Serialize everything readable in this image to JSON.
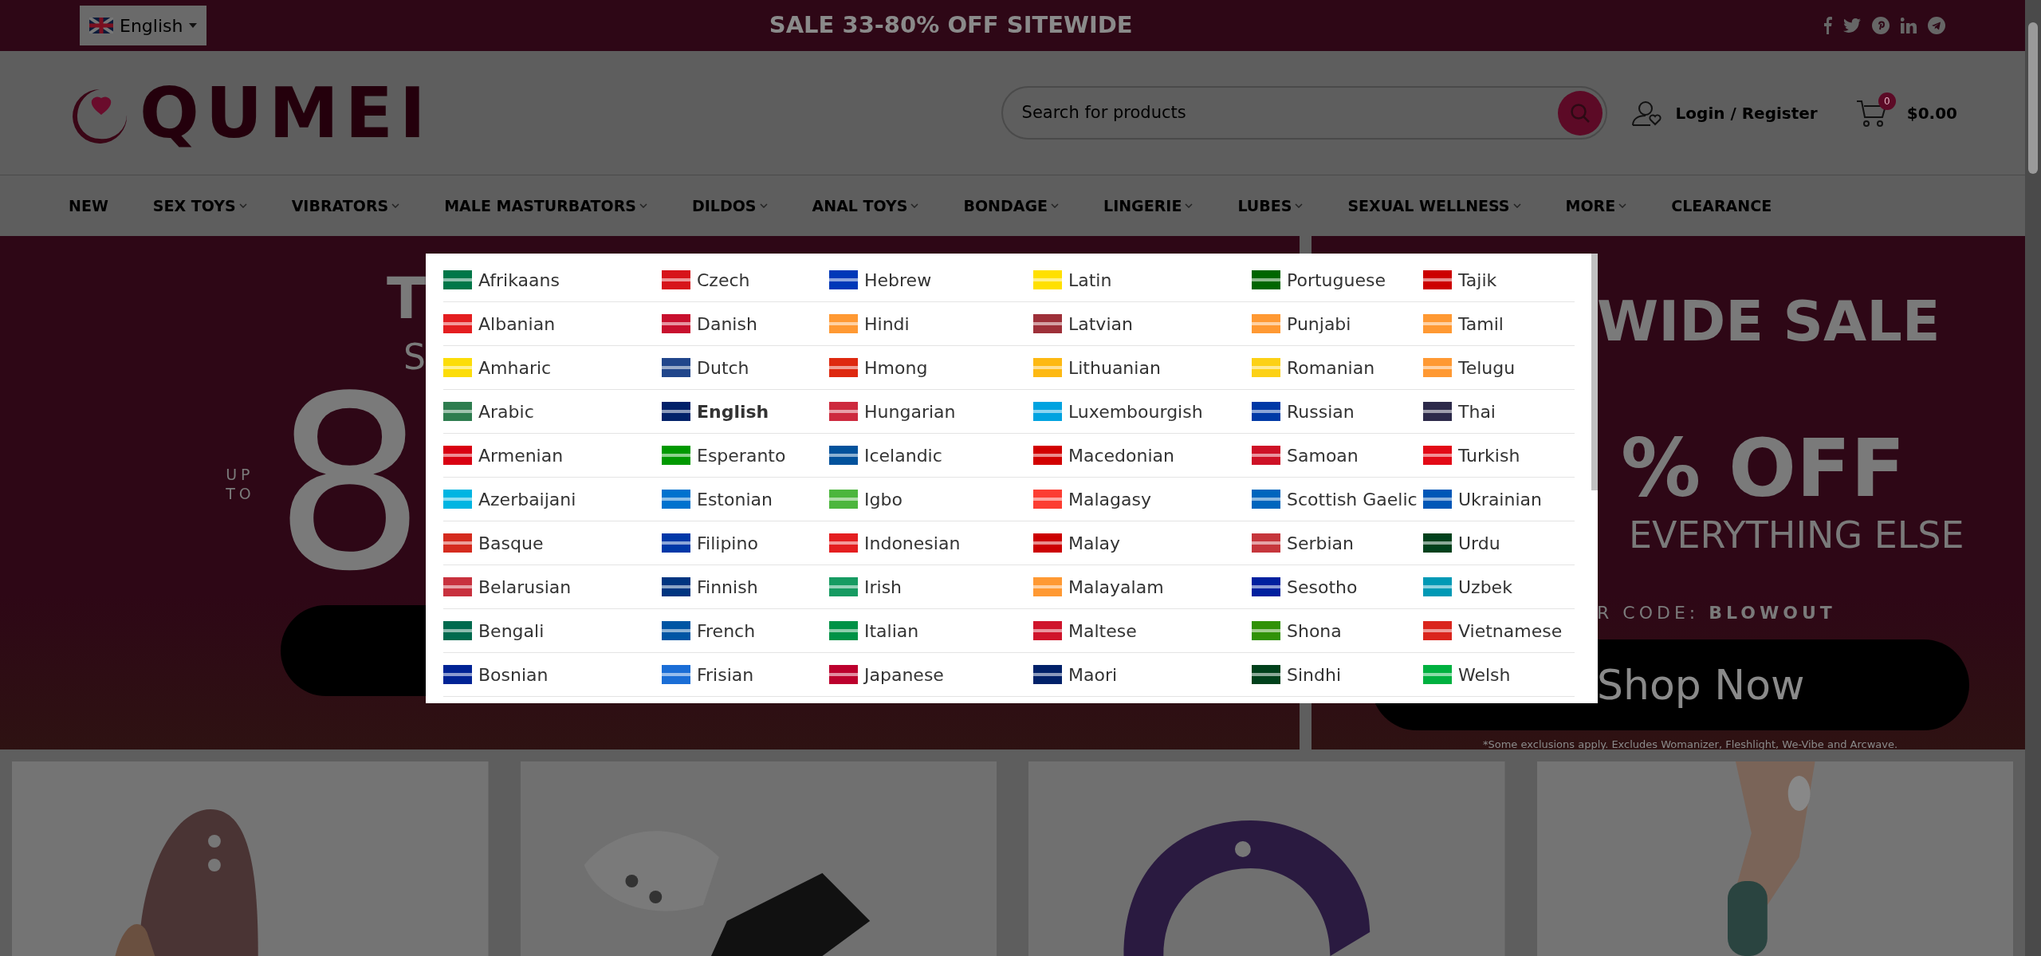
{
  "top_bar": {
    "language_select": "English",
    "promo": "SALE 33-80% OFF SITEWIDE"
  },
  "header": {
    "logo": "QUMEI",
    "search": {
      "placeholder": "Search for products"
    },
    "account": "Login / Register",
    "cart": {
      "count": "0",
      "total": "$0.00"
    }
  },
  "nav": [
    {
      "label": "NEW",
      "dropdown": false
    },
    {
      "label": "SEX TOYS",
      "dropdown": true
    },
    {
      "label": "VIBRATORS",
      "dropdown": true
    },
    {
      "label": "MALE MASTURBATORS",
      "dropdown": true
    },
    {
      "label": "DILDOS",
      "dropdown": true
    },
    {
      "label": "ANAL TOYS",
      "dropdown": true
    },
    {
      "label": "BONDAGE",
      "dropdown": true
    },
    {
      "label": "LINGERIE",
      "dropdown": true
    },
    {
      "label": "LUBES",
      "dropdown": true
    },
    {
      "label": "SEXUAL WELLNESS",
      "dropdown": true
    },
    {
      "label": "MORE",
      "dropdown": true
    },
    {
      "label": "CLEARANCE",
      "dropdown": false
    }
  ],
  "banner_left": {
    "title": "T",
    "subtitle": "S",
    "prefix": "UP TO",
    "number": "8"
  },
  "banner_right": {
    "title": "WIDE SALE",
    "discount": "% OFF",
    "subline": "EVERYTHING ELSE",
    "code_label": "R CODE: ",
    "code": "BLOWOUT",
    "button": "Shop Now",
    "note": "*Some exclusions apply. Excludes Womanizer, Fleshlight, We-Vibe and Arcwave."
  },
  "language_menu": {
    "columns": [
      [
        {
          "label": "Afrikaans",
          "selected": false,
          "color": "#007749"
        },
        {
          "label": "Albanian",
          "selected": false,
          "color": "#e41e20"
        },
        {
          "label": "Amharic",
          "selected": false,
          "color": "#fcdd09"
        },
        {
          "label": "Arabic",
          "selected": false,
          "color": "#2e7d4f"
        },
        {
          "label": "Armenian",
          "selected": false,
          "color": "#d90012"
        },
        {
          "label": "Azerbaijani",
          "selected": false,
          "color": "#00b5e2"
        },
        {
          "label": "Basque",
          "selected": false,
          "color": "#d52b1e"
        },
        {
          "label": "Belarusian",
          "selected": false,
          "color": "#c8313e"
        },
        {
          "label": "Bengali",
          "selected": false,
          "color": "#006a4e"
        },
        {
          "label": "Bosnian",
          "selected": false,
          "color": "#002395"
        }
      ],
      [
        {
          "label": "Czech",
          "selected": false,
          "color": "#d7141a"
        },
        {
          "label": "Danish",
          "selected": false,
          "color": "#c8102e"
        },
        {
          "label": "Dutch",
          "selected": false,
          "color": "#21468b"
        },
        {
          "label": "English",
          "selected": true,
          "color": "#012169"
        },
        {
          "label": "Esperanto",
          "selected": false,
          "color": "#009900"
        },
        {
          "label": "Estonian",
          "selected": false,
          "color": "#0072ce"
        },
        {
          "label": "Filipino",
          "selected": false,
          "color": "#0038a8"
        },
        {
          "label": "Finnish",
          "selected": false,
          "color": "#003580"
        },
        {
          "label": "French",
          "selected": false,
          "color": "#0055a4"
        },
        {
          "label": "Frisian",
          "selected": false,
          "color": "#1b6ed6"
        }
      ],
      [
        {
          "label": "Hebrew",
          "selected": false,
          "color": "#0038b8"
        },
        {
          "label": "Hindi",
          "selected": false,
          "color": "#ff9933"
        },
        {
          "label": "Hmong",
          "selected": false,
          "color": "#de2910"
        },
        {
          "label": "Hungarian",
          "selected": false,
          "color": "#cd2a3e"
        },
        {
          "label": "Icelandic",
          "selected": false,
          "color": "#02529c"
        },
        {
          "label": "Igbo",
          "selected": false,
          "color": "#4cb63d"
        },
        {
          "label": "Indonesian",
          "selected": false,
          "color": "#e41e20"
        },
        {
          "label": "Irish",
          "selected": false,
          "color": "#169b62"
        },
        {
          "label": "Italian",
          "selected": false,
          "color": "#009246"
        },
        {
          "label": "Japanese",
          "selected": false,
          "color": "#bc002d"
        }
      ],
      [
        {
          "label": "Latin",
          "selected": false,
          "color": "#ffe000"
        },
        {
          "label": "Latvian",
          "selected": false,
          "color": "#9e3039"
        },
        {
          "label": "Lithuanian",
          "selected": false,
          "color": "#fdb913"
        },
        {
          "label": "Luxembourgish",
          "selected": false,
          "color": "#00a3e0"
        },
        {
          "label": "Macedonian",
          "selected": false,
          "color": "#d20000"
        },
        {
          "label": "Malagasy",
          "selected": false,
          "color": "#fc3d32"
        },
        {
          "label": "Malay",
          "selected": false,
          "color": "#cc0001"
        },
        {
          "label": "Malayalam",
          "selected": false,
          "color": "#ff9933"
        },
        {
          "label": "Maltese",
          "selected": false,
          "color": "#cf142b"
        },
        {
          "label": "Maori",
          "selected": false,
          "color": "#012169"
        }
      ],
      [
        {
          "label": "Portuguese",
          "selected": false,
          "color": "#006600"
        },
        {
          "label": "Punjabi",
          "selected": false,
          "color": "#ff9933"
        },
        {
          "label": "Romanian",
          "selected": false,
          "color": "#fcd116"
        },
        {
          "label": "Russian",
          "selected": false,
          "color": "#0039a6"
        },
        {
          "label": "Samoan",
          "selected": false,
          "color": "#ce1126"
        },
        {
          "label": "Scottish Gaelic",
          "selected": false,
          "color": "#0065bd"
        },
        {
          "label": "Serbian",
          "selected": false,
          "color": "#c6363c"
        },
        {
          "label": "Sesotho",
          "selected": false,
          "color": "#00209f"
        },
        {
          "label": "Shona",
          "selected": false,
          "color": "#319208"
        },
        {
          "label": "Sindhi",
          "selected": false,
          "color": "#01411c"
        }
      ],
      [
        {
          "label": "Tajik",
          "selected": false,
          "color": "#cc0000"
        },
        {
          "label": "Tamil",
          "selected": false,
          "color": "#ff9933"
        },
        {
          "label": "Telugu",
          "selected": false,
          "color": "#ff9933"
        },
        {
          "label": "Thai",
          "selected": false,
          "color": "#2d2a4a"
        },
        {
          "label": "Turkish",
          "selected": false,
          "color": "#e30a17"
        },
        {
          "label": "Ukrainian",
          "selected": false,
          "color": "#0057b7"
        },
        {
          "label": "Urdu",
          "selected": false,
          "color": "#01411c"
        },
        {
          "label": "Uzbek",
          "selected": false,
          "color": "#0099b5"
        },
        {
          "label": "Vietnamese",
          "selected": false,
          "color": "#da251d"
        },
        {
          "label": "Welsh",
          "selected": false,
          "color": "#00b140"
        }
      ]
    ]
  }
}
